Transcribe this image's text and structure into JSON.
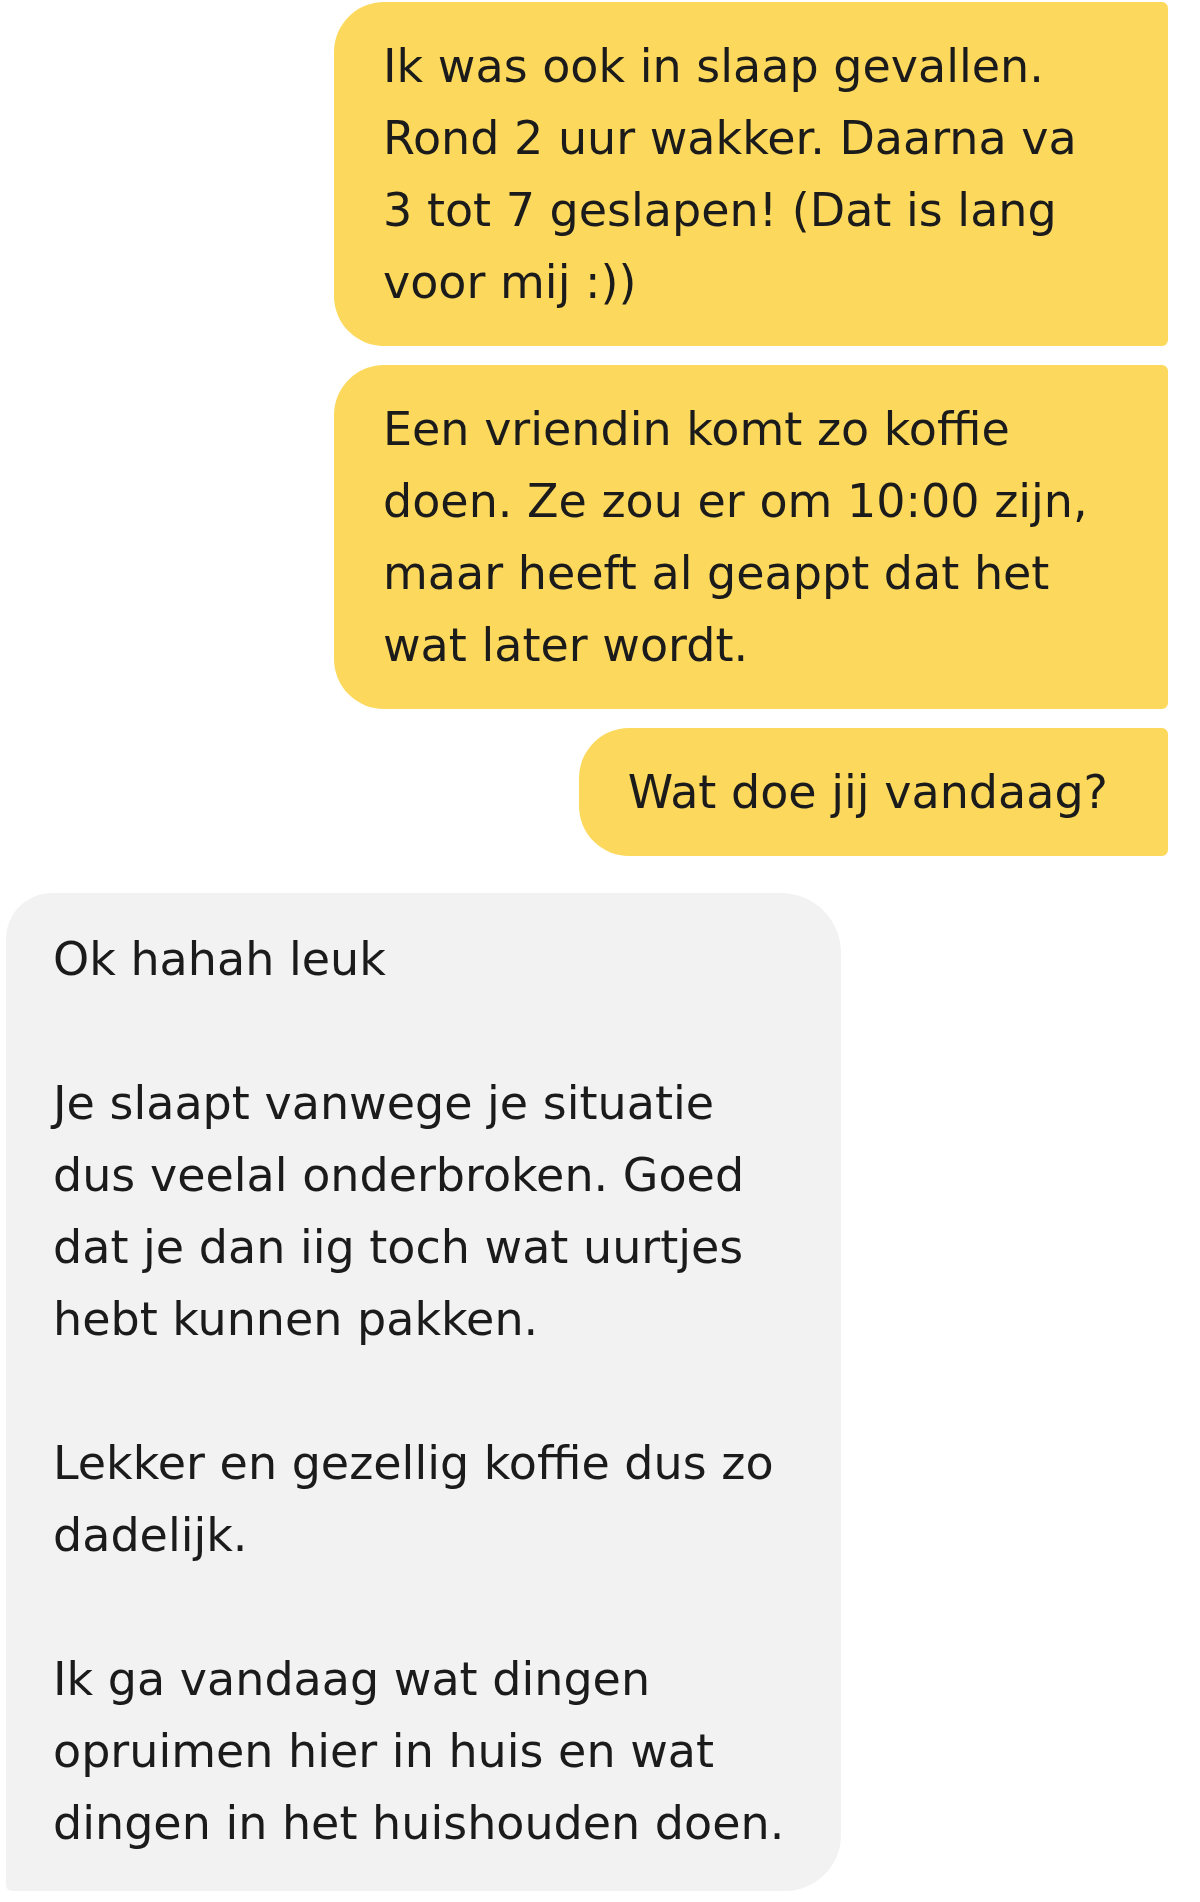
{
  "messages": [
    {
      "kind": "outgoing",
      "paragraphs": [
        "Ik was ook in slaap gevallen. Rond 2 uur wakker. Daarna va 3 tot 7 geslapen! (Dat is lang voor mij :))"
      ]
    },
    {
      "kind": "outgoing",
      "paragraphs": [
        "Een vriendin komt zo koffie doen. Ze zou er om 10:00 zijn, maar heeft al geappt dat het wat later wordt."
      ]
    },
    {
      "kind": "outgoing",
      "paragraphs": [
        "Wat doe jij vandaag?"
      ]
    },
    {
      "kind": "incoming",
      "paragraphs": [
        "Ok hahah leuk",
        "Je slaapt vanwege je situatie dus veelal onderbroken. Goed dat je dan iig toch wat uurtjes hebt kunnen pakken.",
        "Lekker en gezellig koffie dus zo dadelijk.",
        "Ik ga vandaag wat dingen opruimen hier in huis en wat dingen in het huishouden doen."
      ]
    }
  ]
}
